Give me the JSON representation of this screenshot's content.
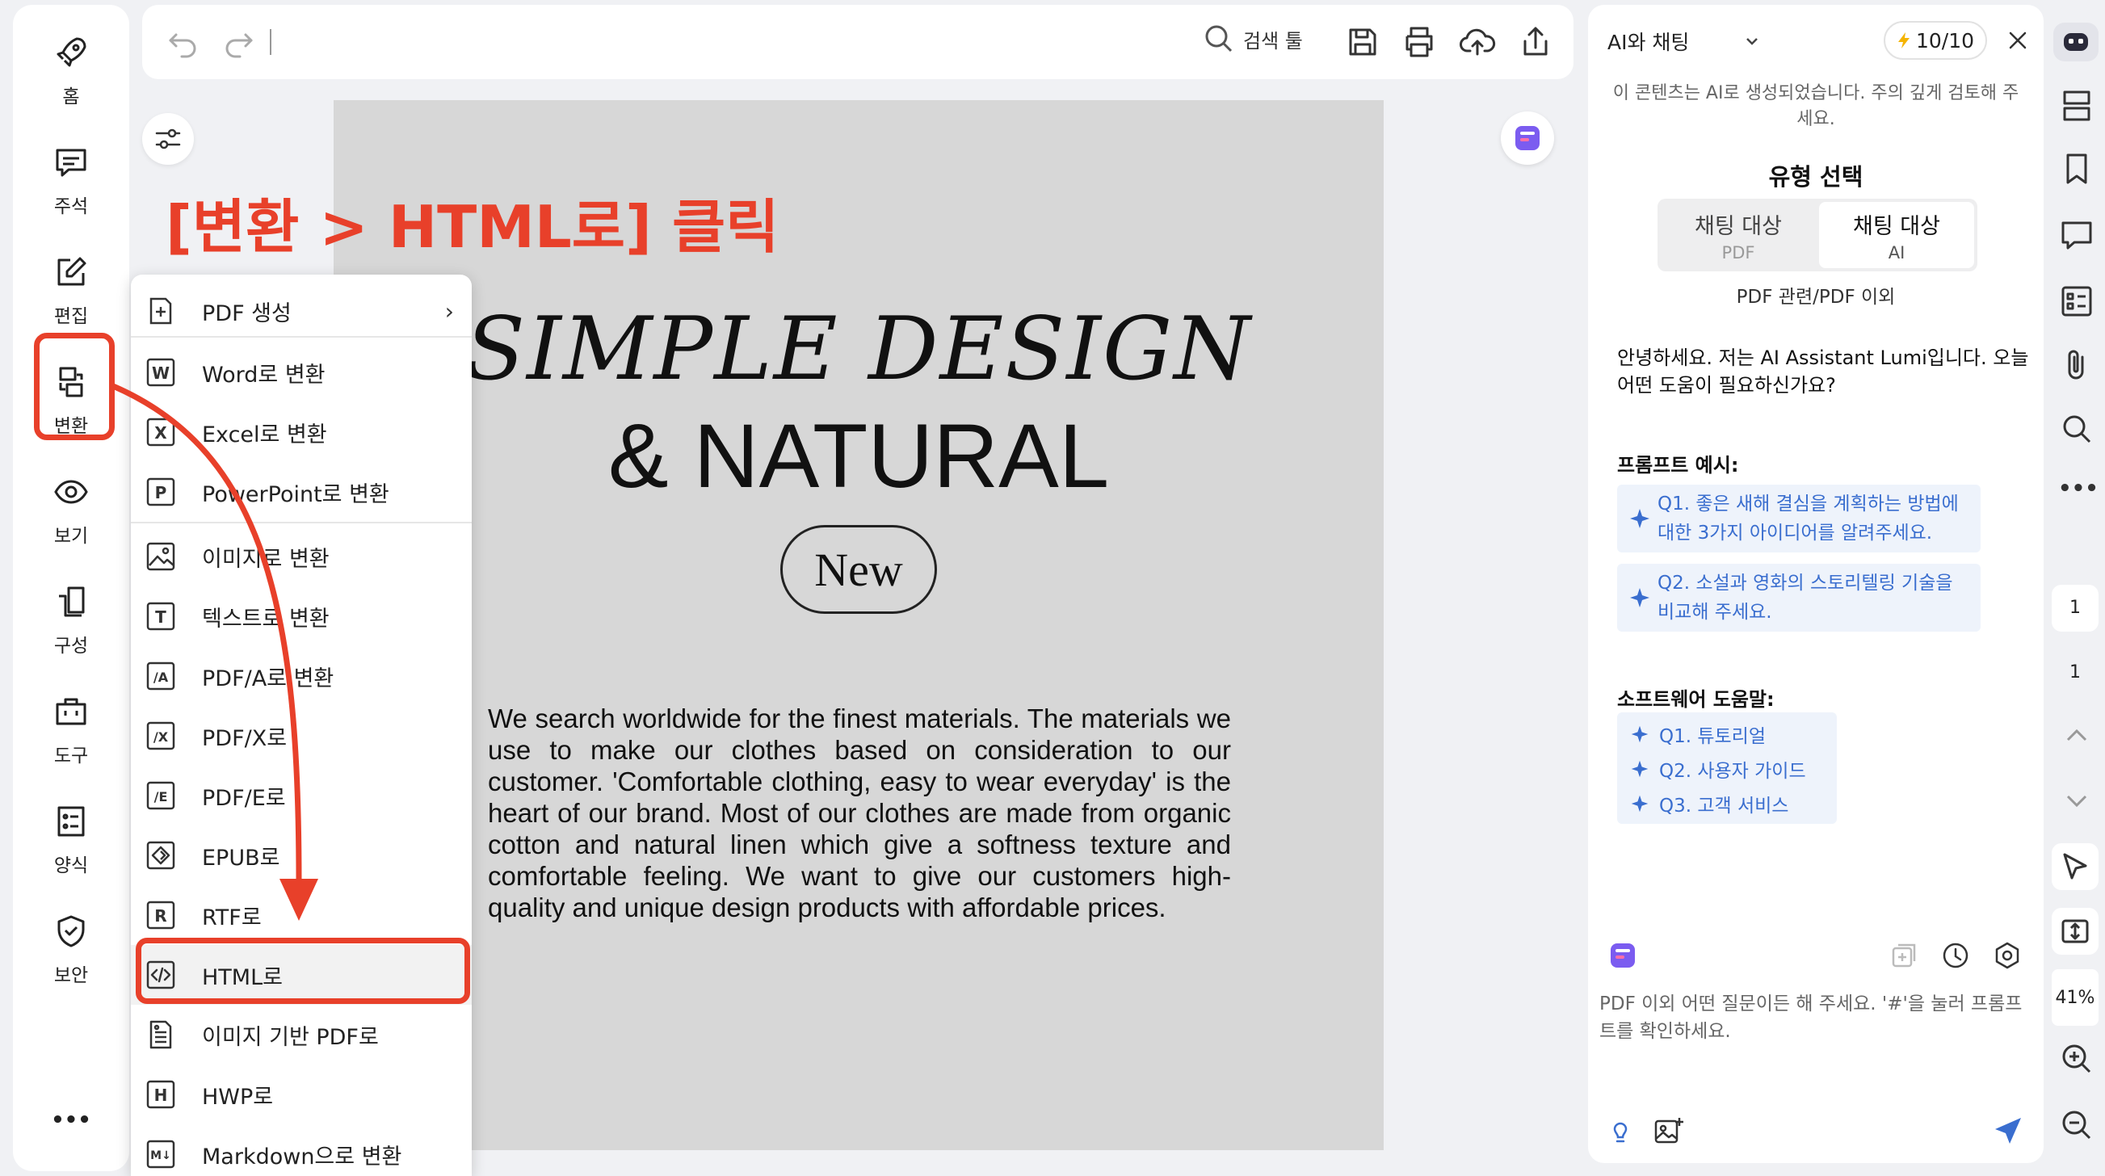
{
  "nav": {
    "items": [
      {
        "label": "홈",
        "icon": "rocket-icon"
      },
      {
        "label": "주석",
        "icon": "comment-icon"
      },
      {
        "label": "편집",
        "icon": "edit-icon"
      },
      {
        "label": "변환",
        "icon": "convert-icon"
      },
      {
        "label": "보기",
        "icon": "eye-icon"
      },
      {
        "label": "구성",
        "icon": "organize-icon"
      },
      {
        "label": "도구",
        "icon": "toolbox-icon"
      },
      {
        "label": "양식",
        "icon": "form-icon"
      },
      {
        "label": "보안",
        "icon": "shield-icon"
      }
    ],
    "more": "•••"
  },
  "toolbar": {
    "search_label": "검색 툴"
  },
  "annotation": {
    "instruction": "[변환 > HTML로] 클릭",
    "color": "#e8402a"
  },
  "menu": {
    "items": [
      {
        "label": "PDF 생성",
        "glyph": "+"
      },
      {
        "label": "Word로 변환",
        "glyph": "W"
      },
      {
        "label": "Excel로 변환",
        "glyph": "X"
      },
      {
        "label": "PowerPoint로 변환",
        "glyph": "P"
      },
      {
        "label": "이미지로 변환",
        "glyph": "img"
      },
      {
        "label": "텍스트로 변환",
        "glyph": "T"
      },
      {
        "label": "PDF/A로 변환",
        "glyph": "/A"
      },
      {
        "label": "PDF/X로",
        "glyph": "/X"
      },
      {
        "label": "PDF/E로",
        "glyph": "/E"
      },
      {
        "label": "EPUB로",
        "glyph": "◇"
      },
      {
        "label": "RTF로",
        "glyph": "R"
      },
      {
        "label": "HTML로",
        "glyph": "</>"
      },
      {
        "label": "이미지 기반 PDF로",
        "glyph": "≡"
      },
      {
        "label": "HWP로",
        "glyph": "H"
      },
      {
        "label": "Markdown으로 변환",
        "glyph": "M↓"
      }
    ],
    "submenu_chevron": "›"
  },
  "document": {
    "title_line1": "SIMPLE DESIGN",
    "title_line2": "& NATURAL",
    "badge": "New",
    "body": "We search worldwide for the finest materials. The materials we use to make our clothes based on consideration to our customer. 'Comfortable clothing, easy to wear everyday' is the heart of our brand. Most of our clothes are made from organic cotton and natural linen which give a softness texture and comfortable feeling. We want to give our customers high-quality and unique design products with affordable prices."
  },
  "ai_panel": {
    "mode": "AI와 채팅",
    "credits": "10/10",
    "notice": "이 콘텐츠는 AI로 생성되었습니다. 주의 깊게 검토해 주세요.",
    "type_heading": "유형 선택",
    "options": [
      {
        "title": "채팅 대상",
        "sub": "PDF",
        "active": false
      },
      {
        "title": "채팅 대상",
        "sub": "AI",
        "active": true
      }
    ],
    "option_caption": "PDF 관련/PDF 이외",
    "greeting": "안녕하세요. 저는 AI Assistant Lumi입니다. 오늘 어떤 도움이 필요하신가요?",
    "prompt_heading": "프롬프트 예시:",
    "prompts": [
      "Q1. 좋은 새해 결심을 계획하는 방법에 대한 3가지 아이디어를 알려주세요.",
      "Q2. 소설과 영화의 스토리텔링 기술을 비교해 주세요."
    ],
    "help_heading": "소프트웨어 도움말:",
    "help": [
      "Q1. 튜토리얼",
      "Q2. 사용자 가이드",
      "Q3. 고객 서비스"
    ],
    "input_placeholder": "PDF 이외 어떤 질문이든 해 주세요. '#'을 눌러 프롬프트를 확인하세요.",
    "accent": "#3a6ecf"
  },
  "rail": {
    "page_current": "1",
    "page_total": "1",
    "zoom": "41%"
  }
}
